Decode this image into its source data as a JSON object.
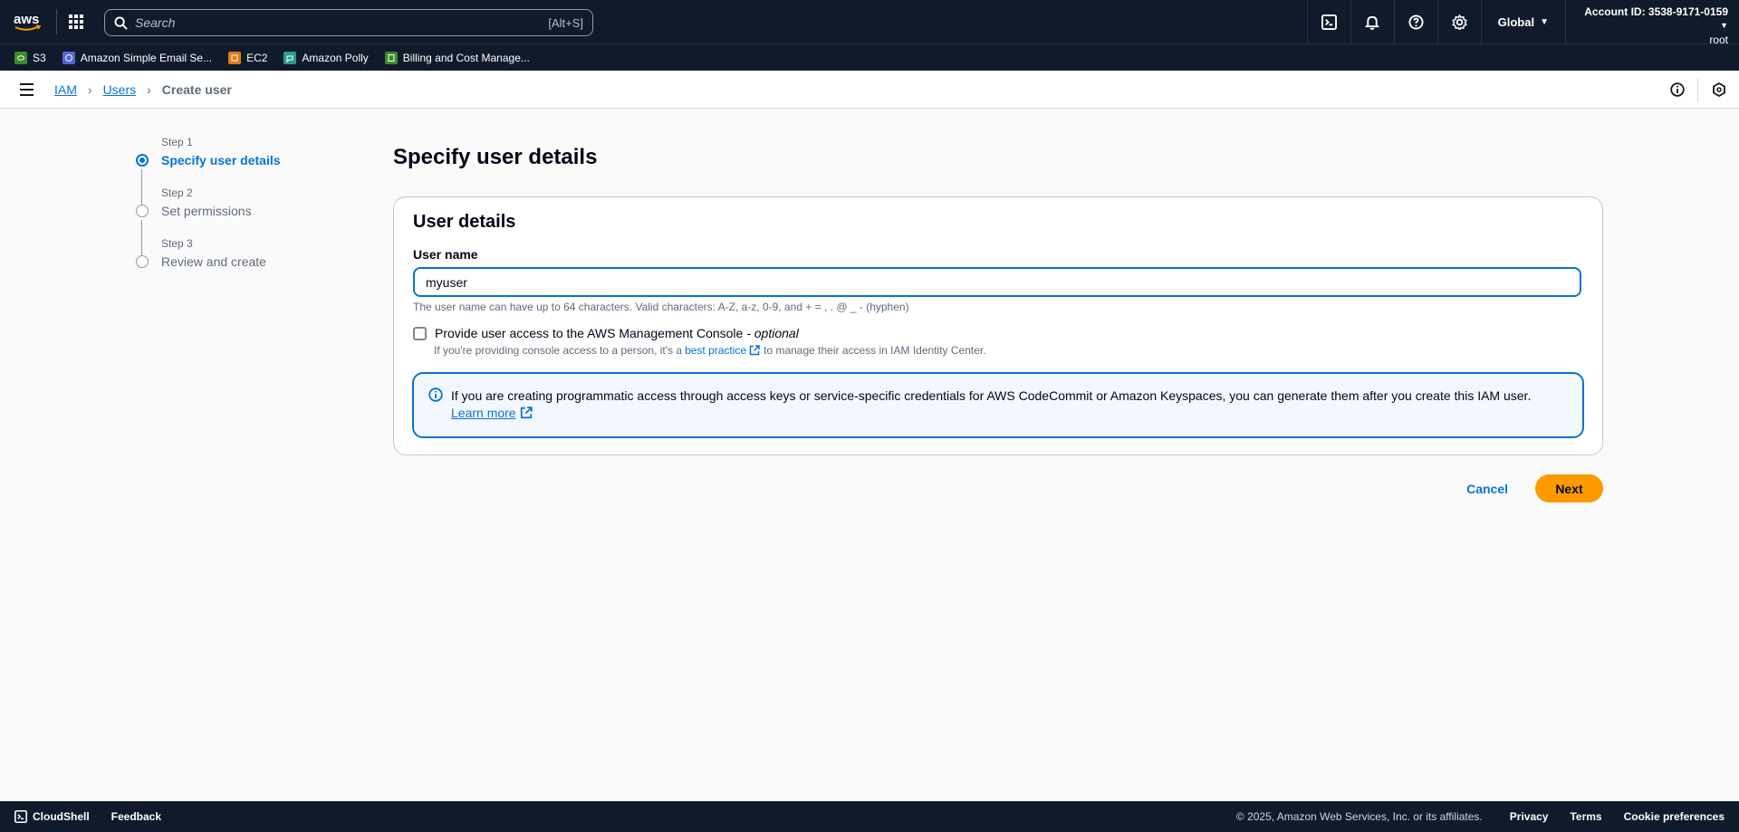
{
  "topnav": {
    "logo_text": "aws",
    "search_placeholder": "Search",
    "search_shortcut": "[Alt+S]",
    "region": "Global",
    "account_id": "Account ID: 3538-9171-0159",
    "account_user": "root"
  },
  "favorites": [
    {
      "label": "S3",
      "color": "#3b8b2b"
    },
    {
      "label": "Amazon Simple Email Se...",
      "color": "#5264d8"
    },
    {
      "label": "EC2",
      "color": "#e07b16"
    },
    {
      "label": "Amazon Polly",
      "color": "#2a9c8a"
    },
    {
      "label": "Billing and Cost Manage...",
      "color": "#3b8b2b"
    }
  ],
  "breadcrumb": {
    "items": [
      "IAM",
      "Users"
    ],
    "current": "Create user"
  },
  "wizard": {
    "steps": [
      {
        "label": "Step 1",
        "title": "Specify user details",
        "active": true
      },
      {
        "label": "Step 2",
        "title": "Set permissions",
        "active": false
      },
      {
        "label": "Step 3",
        "title": "Review and create",
        "active": false
      }
    ]
  },
  "main": {
    "title": "Specify user details",
    "card_title": "User details",
    "username_label": "User name",
    "username_value": "myuser",
    "username_constraint": "The user name can have up to 64 characters. Valid characters: A-Z, a-z, 0-9, and + = , . @ _ - (hyphen)",
    "console_access_label": "Provide user access to the AWS Management Console",
    "console_access_optional": "- optional",
    "console_access_checked": false,
    "console_desc_prefix": "If you're providing console access to a person, it's a",
    "console_desc_link": "best practice",
    "console_desc_suffix": "to manage their access in IAM Identity Center.",
    "info_text": "If you are creating programmatic access through access keys or service-specific credentials for AWS CodeCommit or Amazon Keyspaces, you can generate them after you create this IAM user.",
    "info_link": "Learn more"
  },
  "actions": {
    "cancel": "Cancel",
    "next": "Next"
  },
  "footer": {
    "cloudshell": "CloudShell",
    "feedback": "Feedback",
    "copyright": "© 2025, Amazon Web Services, Inc. or its affiliates.",
    "links": [
      "Privacy",
      "Terms",
      "Cookie preferences"
    ]
  },
  "colors": {
    "nav_bg": "#0f1b2a",
    "link_blue": "#0972d3",
    "primary_orange": "#ff9900"
  }
}
